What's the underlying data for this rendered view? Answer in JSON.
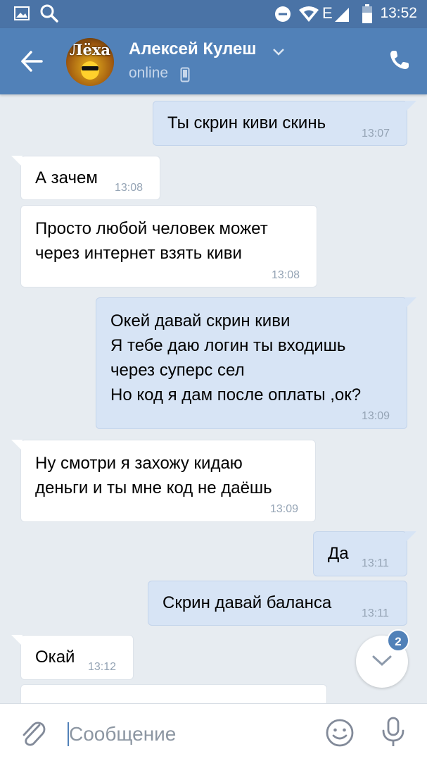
{
  "status_bar": {
    "time": "13:52"
  },
  "header": {
    "back_icon": "arrow-left-icon",
    "avatar_text": "Лёха",
    "contact_name": "Алексей Кулеш",
    "status": "online",
    "call_icon": "phone-icon"
  },
  "messages": [
    {
      "dir": "out",
      "text": "Ты скрин киви скинь",
      "time": "13:07"
    },
    {
      "dir": "in",
      "text": "А зачем",
      "time": "13:08"
    },
    {
      "dir": "in",
      "text": "Просто любой человек может\nчерез интернет взять киви",
      "time": "13:08"
    },
    {
      "dir": "out",
      "text": "Окей давай скрин киви\nЯ тебе даю логин ты входишь\nчерез суперс сел\nНо код я дам после оплаты ,ок?",
      "time": "13:09"
    },
    {
      "dir": "in",
      "text": "Ну смотри я захожу кидаю\nденьги и ты мне код не даёшь",
      "time": "13:09"
    },
    {
      "dir": "out",
      "text": "Да",
      "time": "13:11"
    },
    {
      "dir": "out",
      "text": "Скрин давай баланса",
      "time": "13:11"
    },
    {
      "dir": "in",
      "text": "Окай",
      "time": "13:12"
    }
  ],
  "scroll_down": {
    "unread_count": "2"
  },
  "composer": {
    "placeholder": "Сообщение"
  },
  "colors": {
    "header": "#5181b8",
    "status_bar": "#4a73a6",
    "outgoing_bubble": "#d7e4f5",
    "incoming_bubble": "#ffffff",
    "background": "#e7ecf1"
  }
}
